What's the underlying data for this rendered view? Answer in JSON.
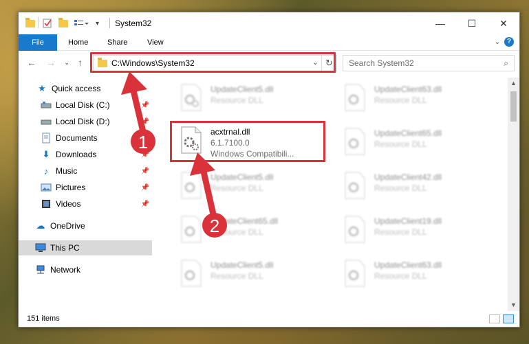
{
  "window": {
    "title": "System32",
    "controls": {
      "minimize": "—",
      "maximize": "☐",
      "close": "✕"
    }
  },
  "ribbon": {
    "tabs": [
      "File",
      "Home",
      "Share",
      "View"
    ],
    "help": "?"
  },
  "nav": {
    "address": "C:\\Windows\\System32",
    "search_placeholder": "Search System32"
  },
  "sidebar": {
    "items": [
      {
        "label": "Quick access",
        "icon": "star-icon",
        "pinned": false
      },
      {
        "label": "Local Disk (C:)",
        "icon": "drive-icon",
        "pinned": true
      },
      {
        "label": "Local Disk (D:)",
        "icon": "drive-icon",
        "pinned": true
      },
      {
        "label": "Documents",
        "icon": "documents-icon",
        "pinned": true
      },
      {
        "label": "Downloads",
        "icon": "download-icon",
        "pinned": true
      },
      {
        "label": "Music",
        "icon": "music-icon",
        "pinned": true
      },
      {
        "label": "Pictures",
        "icon": "pictures-icon",
        "pinned": true
      },
      {
        "label": "Videos",
        "icon": "videos-icon",
        "pinned": true
      },
      {
        "label": "OneDrive",
        "icon": "cloud-icon",
        "pinned": false
      },
      {
        "label": "This PC",
        "icon": "computer-icon",
        "pinned": false,
        "selected": true
      },
      {
        "label": "Network",
        "icon": "network-icon",
        "pinned": false
      }
    ]
  },
  "files": {
    "highlighted": {
      "name": "acxtrnal.dll",
      "version": "6.1.7100.0",
      "description": "Windows Compatibili..."
    },
    "left_column": [
      {
        "name": "UpdateClient5.dll",
        "type": "Resource DLL"
      },
      {
        "name": "UpdateClient5.dll",
        "type": "Resource DLL"
      },
      {
        "name": "UpdateClient65.dll",
        "type": "Resource DLL"
      },
      {
        "name": "UpdateClient5.dll",
        "type": "Resource DLL"
      }
    ],
    "right_column": [
      {
        "name": "UpdateClient63.dll",
        "type": "Resource DLL"
      },
      {
        "name": "UpdateClient65.dll",
        "type": "Resource DLL"
      },
      {
        "name": "UpdateClient42.dll",
        "type": "Resource DLL"
      },
      {
        "name": "UpdateClient19.dll",
        "type": "Resource DLL"
      },
      {
        "name": "UpdateClient63.dll",
        "type": "Resource DLL"
      }
    ]
  },
  "status": {
    "item_count": "151 items"
  },
  "annotations": {
    "step1": "1",
    "step2": "2"
  },
  "colors": {
    "accent": "#1979ca",
    "highlight": "#d9323a",
    "selected": "#cce8ff"
  }
}
